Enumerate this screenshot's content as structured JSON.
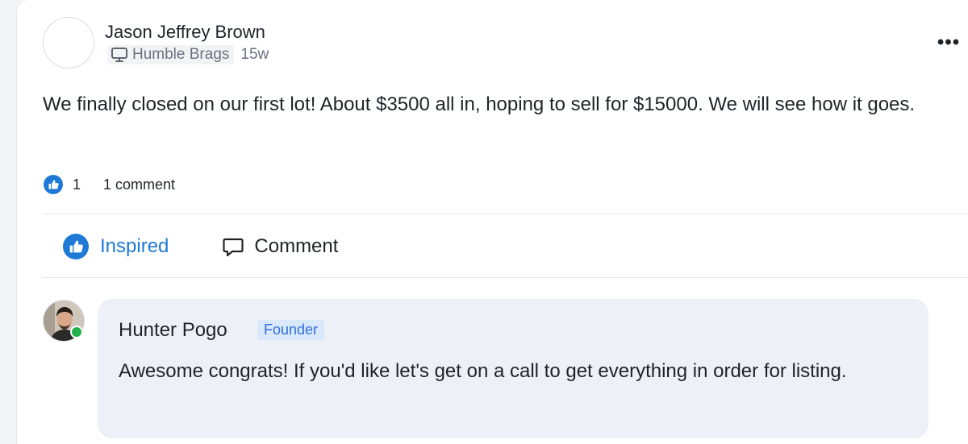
{
  "post": {
    "author": "Jason Jeffrey Brown",
    "space": "Humble Brags",
    "time": "15w",
    "body": "We finally closed on our first lot! About $3500 all in, hoping to sell for $15000. We will see how it goes.",
    "likes": "1",
    "comments": "1 comment"
  },
  "actions": {
    "inspired_label": "Inspired",
    "comment_label": "Comment"
  },
  "comment": {
    "author": "Hunter Pogo",
    "badge": "Founder",
    "text": "Awesome congrats! If you'd like let's get on a call to get everything in order for listing.",
    "online": true
  },
  "colors": {
    "accent": "#1e7ad6",
    "online": "#22b14c",
    "bubble": "#edf1f7",
    "badge_bg": "#d9e8fa",
    "badge_text": "#2f6fd8"
  },
  "icons": {
    "space": "monitor-icon",
    "more": "more-dots-icon",
    "like": "thumbs-up-icon",
    "comment": "speech-bubble-icon"
  }
}
